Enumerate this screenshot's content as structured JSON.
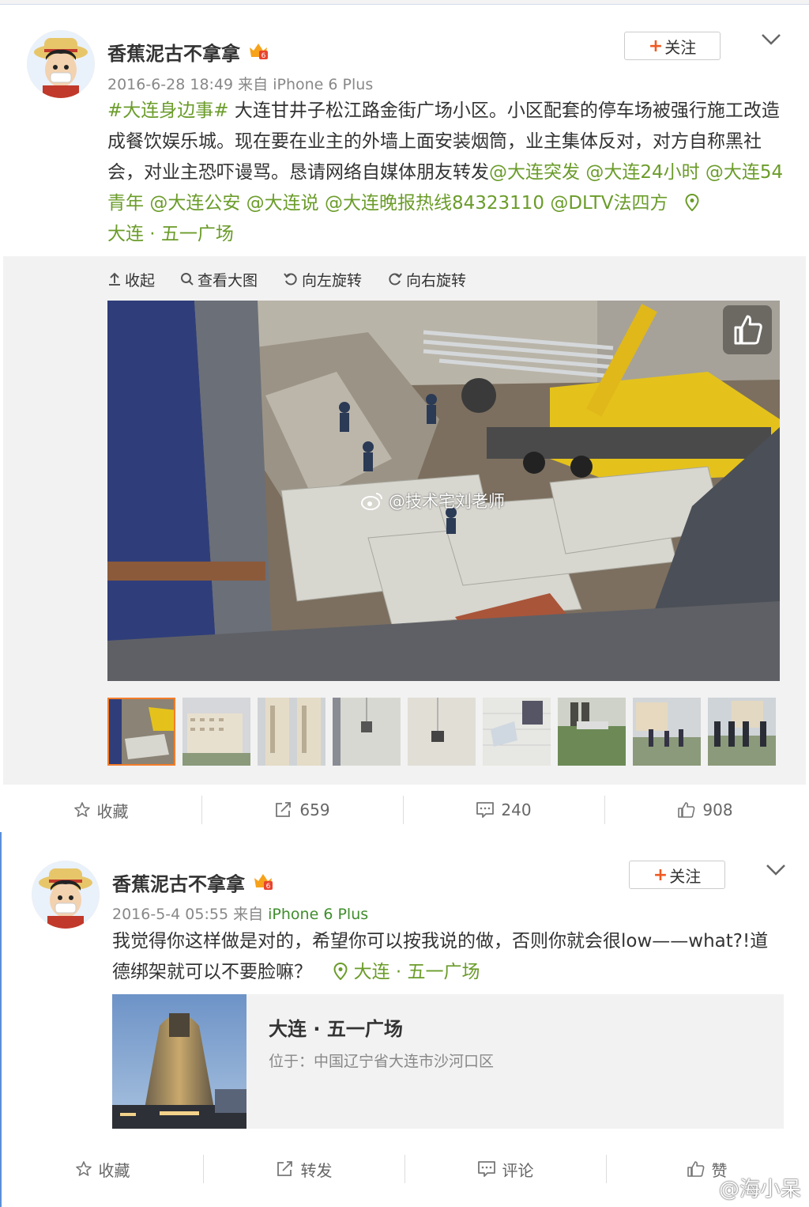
{
  "post1": {
    "username": "香蕉泥古不拿拿",
    "follow_label": "关注",
    "time": "2016-6-28 18:49",
    "from": "来自",
    "source": "iPhone 6 Plus",
    "topic": "#大连身边事#",
    "body": " 大连甘井子松江路金街广场小区。小区配套的停车场被强行施工改造成餐饮娱乐城。现在要在业主的外墙上面安装烟筒，业主集体反对，对方自称黑社会，对业主恐吓谩骂。恳请网络自媒体朋友转发",
    "mentions": [
      "@大连突发",
      "@大连24小时",
      "@大连54青年",
      "@大连公安",
      "@大连说",
      "@大连晚报热线84323110",
      "@DLTV法四方"
    ],
    "location": "大连 · 五一广场",
    "toolbar": {
      "collapse": "收起",
      "view_large": "查看大图",
      "rotate_left": "向左旋转",
      "rotate_right": "向右旋转"
    },
    "image_watermark": "@技术宅刘老师",
    "thumbnail_count": 9,
    "actions": {
      "favorite": "收藏",
      "repost": "659",
      "comment": "240",
      "like": "908"
    }
  },
  "post2": {
    "username": "香蕉泥古不拿拿",
    "follow_label": "关注",
    "time": "2016-5-4 05:55",
    "from": "来自",
    "source": "iPhone 6 Plus",
    "body": "我觉得你这样做是对的，希望你可以按我说的做，否则你就会很low——what?!道德绑架就可以不要脸嘛？",
    "location": "大连 · 五一广场",
    "location_card": {
      "title": "大连 · 五一广场",
      "address": "位于：中国辽宁省大连市沙河口区"
    },
    "actions": {
      "favorite": "收藏",
      "repost": "转发",
      "comment": "评论",
      "like": "赞"
    }
  },
  "watermark": "@海小呆",
  "colors": {
    "link_green": "#6b9c2a",
    "follow_plus": "#f05a22",
    "thumb_active": "#f37d2a"
  }
}
